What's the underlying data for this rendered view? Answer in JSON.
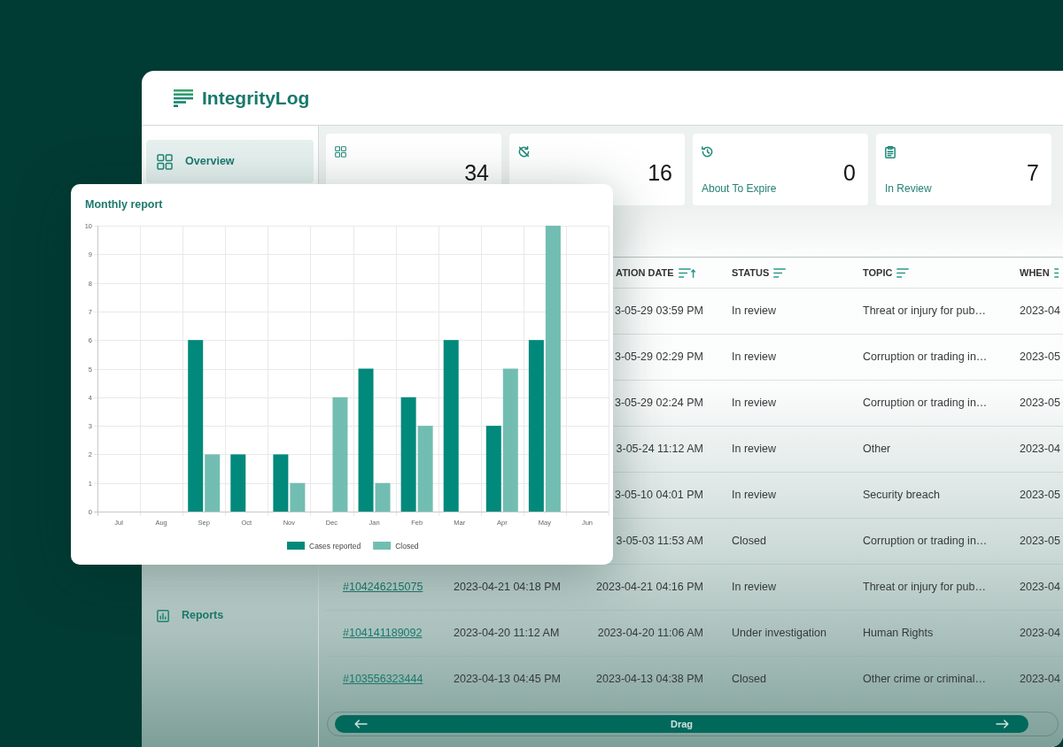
{
  "app": {
    "title": "IntegrityLog"
  },
  "sidebar": {
    "items": [
      {
        "label": "Overview",
        "selected": true
      }
    ],
    "bottom_items": [
      {
        "label": "Reports",
        "selected": false
      }
    ]
  },
  "stats": [
    {
      "value": "34"
    },
    {
      "value": "16"
    },
    {
      "label": "About To Expire",
      "value": "0"
    },
    {
      "label": "In Review",
      "value": "7"
    }
  ],
  "table": {
    "header": {
      "column_3": {
        "label": "ATION DATE",
        "sorted": true
      },
      "column_4": {
        "label": "STATUS",
        "sorted": false
      },
      "column_5": {
        "label": "TOPIC",
        "sorted": false
      },
      "column_6": {
        "label": "WHEN"
      }
    },
    "rows": [
      {
        "column_3": "3-05-29 03:59 PM",
        "column_4": "In review",
        "column_5": "Threat or injury for pub…",
        "column_6": "2023-04"
      },
      {
        "column_3": "3-05-29 02:29 PM",
        "column_4": "In review",
        "column_5": "Corruption or trading in…",
        "column_6": "2023-05"
      },
      {
        "column_3": "3-05-29 02:24 PM",
        "column_4": "In review",
        "column_5": "Corruption or trading in…",
        "column_6": "2023-05"
      },
      {
        "column_3": "3-05-24 11:12 AM",
        "column_4": "In review",
        "column_5": "Other",
        "column_6": "2023-04"
      },
      {
        "column_3": "3-05-10 04:01 PM",
        "column_4": "In review",
        "column_5": "Security breach",
        "column_6": "2023-05"
      },
      {
        "column_3": "3-05-03 11:53 AM",
        "column_4": "Closed",
        "column_5": "Corruption or trading in…",
        "column_6": "2023-05"
      },
      {
        "column_1": "#104246215075",
        "column_2": "2023-04-21 04:18 PM",
        "column_3": "2023-04-21 04:16 PM",
        "column_4": "In review",
        "column_5": "Threat or injury for pub…",
        "column_6": "2023-04"
      },
      {
        "column_1": "#104141189092",
        "column_2": "2023-04-20 11:12 AM",
        "column_3": "2023-04-20 11:06 AM",
        "column_4": "Under investigation",
        "column_5": "Human Rights",
        "column_6": "2023-04"
      },
      {
        "column_1": "#103556323444",
        "column_2": "2023-04-13 04:45 PM",
        "column_3": "2023-04-13 04:38 PM",
        "column_4": "Closed",
        "column_5": "Other crime or criminal…",
        "column_6": "2023-04"
      }
    ]
  },
  "scrollbar": {
    "label": "Drag"
  },
  "chart_card": {
    "chart_data": {
      "type": "bar",
      "title": "Monthly report",
      "categories": [
        "Jul",
        "Aug",
        "Sep",
        "Oct",
        "Nov",
        "Dec",
        "Jan",
        "Feb",
        "Mar",
        "Apr",
        "May",
        "Jun"
      ],
      "series": [
        {
          "name": "Cases reported",
          "color": "#01897b",
          "values": [
            0,
            0,
            6,
            2,
            2,
            0,
            5,
            4,
            6,
            3,
            6,
            0
          ]
        },
        {
          "name": "Closed",
          "color": "#72bdb2",
          "values": [
            0,
            0,
            2,
            0,
            1,
            4,
            1,
            3,
            0,
            5,
            10,
            0
          ]
        }
      ],
      "ylim": [
        0,
        10
      ],
      "yticks": [
        0,
        1,
        2,
        3,
        4,
        5,
        6,
        7,
        8,
        9,
        10
      ],
      "grid": true,
      "legend": "bottom"
    }
  }
}
